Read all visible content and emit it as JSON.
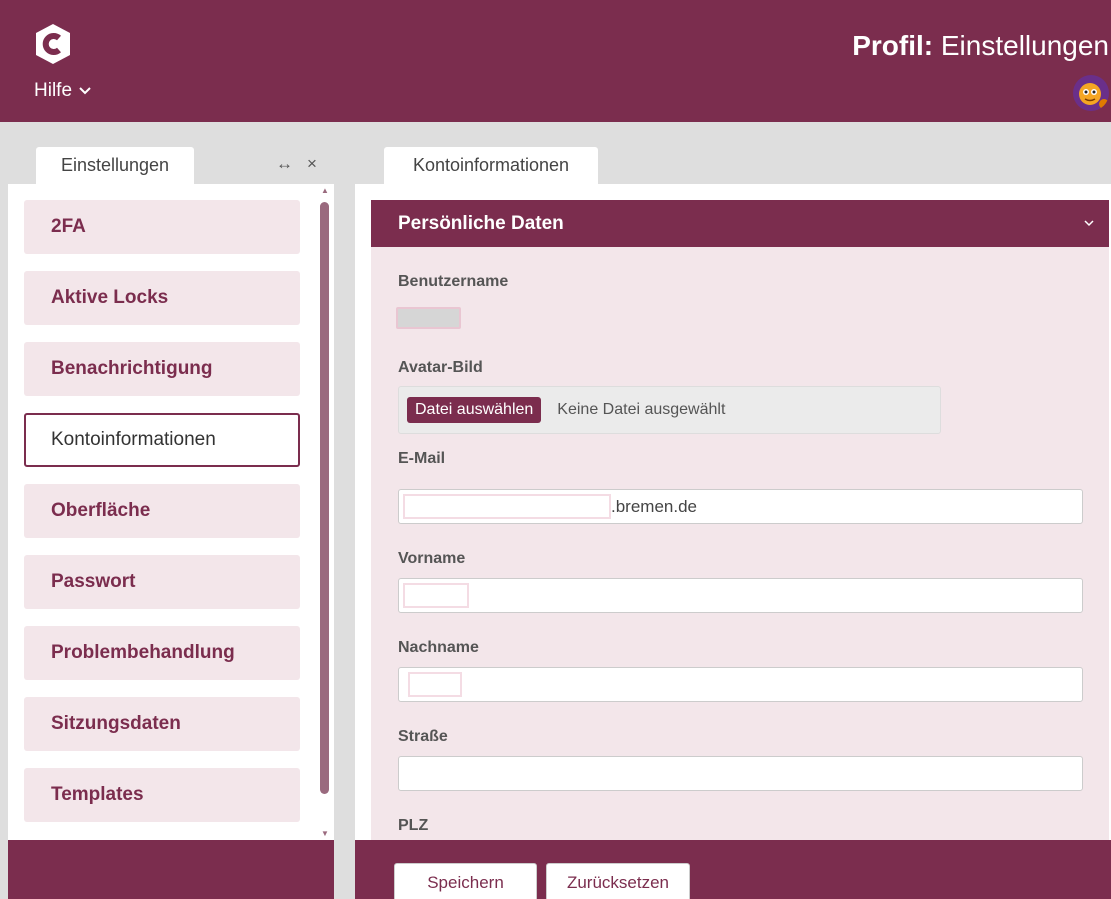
{
  "header": {
    "help_label": "Hilfe",
    "title_bold": "Profil:",
    "title_rest": "Einstellungen"
  },
  "tabs": {
    "left_label": "Einstellungen",
    "expand_glyph": "↔",
    "close_glyph": "×",
    "right_label": "Kontoinformationen"
  },
  "sidebar": {
    "items": [
      {
        "label": "2FA"
      },
      {
        "label": "Aktive Locks"
      },
      {
        "label": "Benachrichtigung"
      },
      {
        "label": "Kontoinformationen"
      },
      {
        "label": "Oberfläche"
      },
      {
        "label": "Passwort"
      },
      {
        "label": "Problembehandlung"
      },
      {
        "label": "Sitzungsdaten"
      },
      {
        "label": "Templates"
      }
    ],
    "active_index": 3
  },
  "panel": {
    "title": "Persönliche Daten",
    "fields": {
      "username_label": "Benutzername",
      "avatar_label": "Avatar-Bild",
      "file_button": "Datei auswählen",
      "file_status": "Keine Datei ausgewählt",
      "email_label": "E-Mail",
      "email_suffix": ".bremen.de",
      "firstname_label": "Vorname",
      "lastname_label": "Nachname",
      "street_label": "Straße",
      "zip_label": "PLZ"
    }
  },
  "footer": {
    "save_label": "Speichern",
    "reset_label": "Zurücksetzen"
  },
  "colors": {
    "brand": "#7b2d4e",
    "panel_bg": "#f3e6ea"
  },
  "icons": {
    "logo": "app-logo-icon",
    "help_chevron": "chevron-down-icon",
    "panel_chevron": "chevron-down-icon",
    "avatar": "user-avatar"
  }
}
